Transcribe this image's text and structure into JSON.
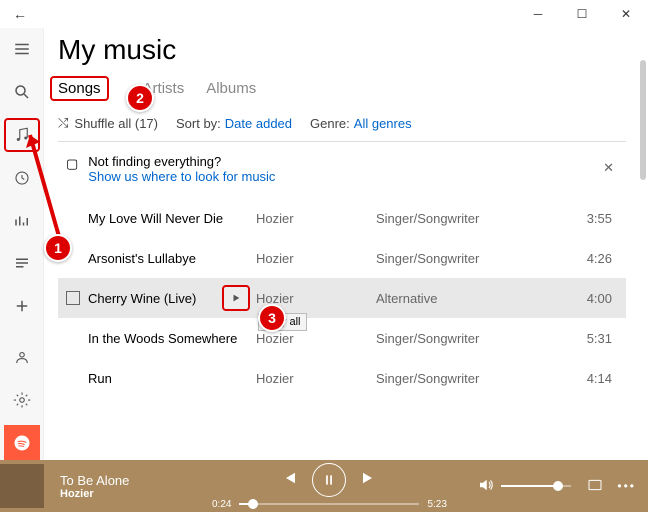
{
  "titlebar": {
    "back": "←"
  },
  "header": {
    "title": "My music"
  },
  "tabs": {
    "songs": "Songs",
    "artists": "Artists",
    "albums": "Albums"
  },
  "controls": {
    "shuffle": "Shuffle all (17)",
    "sortLabel": "Sort by:",
    "sortValue": "Date added",
    "genreLabel": "Genre:",
    "genreValue": "All genres"
  },
  "notice": {
    "title": "Not finding everything?",
    "link": "Show us where to look for music"
  },
  "tooltip": "Play all",
  "songs": [
    {
      "title": "My Love Will Never Die",
      "artist": "Hozier",
      "genre": "Singer/Songwriter",
      "time": "3:55"
    },
    {
      "title": "Arsonist's Lullabye",
      "artist": "Hozier",
      "genre": "Singer/Songwriter",
      "time": "4:26"
    },
    {
      "title": "Cherry Wine (Live)",
      "artist": "Hozier",
      "genre": "Alternative",
      "time": "4:00"
    },
    {
      "title": "In the Woods Somewhere",
      "artist": "Hozier",
      "genre": "Singer/Songwriter",
      "time": "5:31"
    },
    {
      "title": "Run",
      "artist": "Hozier",
      "genre": "Singer/Songwriter",
      "time": "4:14"
    }
  ],
  "player": {
    "title": "To Be Alone",
    "artist": "Hozier",
    "elapsed": "0:24",
    "total": "5:23",
    "progressPct": 7
  },
  "annotations": {
    "a1": "1",
    "a2": "2",
    "a3": "3"
  }
}
